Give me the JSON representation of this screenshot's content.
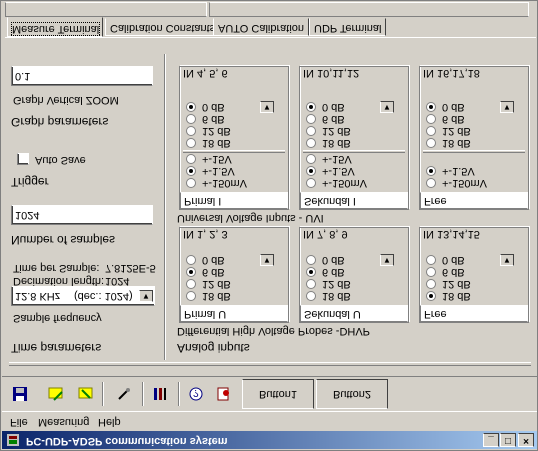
{
  "window": {
    "title": "PC-UDP-ADSP communication system"
  },
  "menu": [
    "File",
    "Measuring",
    "Help"
  ],
  "toolbar": {
    "tabs": [
      "Button1",
      "Button2"
    ]
  },
  "tabs": [
    "Measure Terminal",
    "Calibration Constants",
    "AUTO Calibration",
    "UDP Terminal"
  ],
  "left": {
    "time_parameters_title": "Time parameters",
    "sample_frequency_label": "Sample frequency",
    "sample_frequency_value": "12.8 KHz",
    "sample_frequency_dec": "(dec.: 1024)",
    "decimation_label": "Decimation length:",
    "decimation_value": "1024",
    "time_per_sample_label": "Time per Sample:",
    "time_per_sample_value": "7.8125E-5",
    "number_samples_label": "Number of samples",
    "number_samples_value": "1024",
    "trigger_title": "Trigger",
    "autosave_label": "Auto Save",
    "graph_title": "Graph parameters",
    "zoom_label": "Graph Vertical ZOOM",
    "zoom_value": "0.1"
  },
  "analog": {
    "title": "Analog inputs",
    "uvi_title": "Universal Voltage Inputs - UVI",
    "dhvp_title": "Differential High Voltage Probes -DHVP",
    "uvi": [
      {
        "name": "Primal I",
        "inputs": "IN 4, 5, 6",
        "ranges": [
          "+-150mV",
          "+-1.5V",
          "+-15V"
        ],
        "range_sel": 1,
        "gains": [
          "18 dB",
          "12 dB",
          "6 dB",
          "0 dB"
        ],
        "gain_sel": 3
      },
      {
        "name": "Sekundal I",
        "inputs": "IN 10,11,12",
        "ranges": [
          "+-150mV",
          "+-1.5V",
          "+-15V"
        ],
        "range_sel": 1,
        "gains": [
          "18 dB",
          "12 dB",
          "6 dB",
          "0 dB"
        ],
        "gain_sel": 3
      },
      {
        "name": "Free",
        "inputs": "IN 16,17,18",
        "ranges": [
          "+-150mV",
          "+-1.5V"
        ],
        "range_sel": 1,
        "gains": [
          "18 dB",
          "12 dB",
          "6 dB",
          "0 dB"
        ],
        "gain_sel": 3
      }
    ],
    "dhvp": [
      {
        "name": "Primal U",
        "inputs": "IN 1, 2, 3",
        "gains": [
          "18 dB",
          "12 dB",
          "6 dB",
          "0 dB"
        ],
        "gain_sel": 2
      },
      {
        "name": "Sekundal U",
        "inputs": "IN 7, 8, 9",
        "gains": [
          "18 dB",
          "12 dB",
          "6 dB",
          "0 dB"
        ],
        "gain_sel": 2
      },
      {
        "name": "Free",
        "inputs": "IN 13,14,15",
        "gains": [
          "18 dB",
          "12 dB",
          "6 dB",
          "0 dB"
        ],
        "gain_sel": 0
      }
    ]
  },
  "colors": {
    "face": "#d4d0c8",
    "title_start": "#0a246a",
    "title_end": "#a6caf0"
  }
}
